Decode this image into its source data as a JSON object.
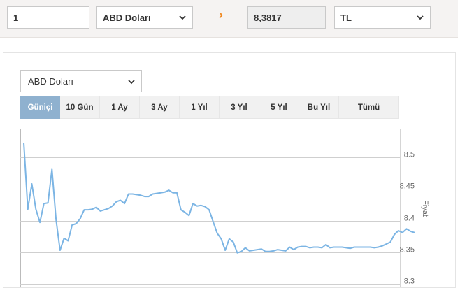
{
  "converter": {
    "amount": "1",
    "from_currency": "ABD Doları",
    "arrow": "›",
    "result": "8,3817",
    "to_currency": "TL"
  },
  "chart_panel": {
    "currency_select": "ABD Doları",
    "periods": [
      {
        "label": "Güniçi",
        "active": true
      },
      {
        "label": "10 Gün",
        "active": false
      },
      {
        "label": "1 Ay",
        "active": false
      },
      {
        "label": "3 Ay",
        "active": false
      },
      {
        "label": "1 Yıl",
        "active": false
      },
      {
        "label": "3 Yıl",
        "active": false
      },
      {
        "label": "5 Yıl",
        "active": false
      },
      {
        "label": "Bu Yıl",
        "active": false
      },
      {
        "label": "Tümü",
        "active": false
      }
    ]
  },
  "colors": {
    "accent": "#f08a24",
    "active_tab": "#8fb1cf",
    "line": "#7cb5e4"
  },
  "chart_data": {
    "type": "line",
    "ylabel": "Fiyat",
    "ylim": [
      8.3,
      8.52
    ],
    "yticks": [
      "8.5",
      "8.45",
      "8.4",
      "8.35",
      "8.3"
    ],
    "ytick_values": [
      8.5,
      8.45,
      8.4,
      8.35,
      8.3
    ],
    "series": [
      {
        "values": [
          8.523,
          8.418,
          8.458,
          8.418,
          8.397,
          8.427,
          8.428,
          8.481,
          8.402,
          8.353,
          8.372,
          8.368,
          8.393,
          8.395,
          8.403,
          8.417,
          8.417,
          8.418,
          8.421,
          8.415,
          8.417,
          8.419,
          8.423,
          8.43,
          8.432,
          8.427,
          8.442,
          8.442,
          8.441,
          8.44,
          8.438,
          8.438,
          8.442,
          8.443,
          8.444,
          8.445,
          8.448,
          8.444,
          8.444,
          8.417,
          8.413,
          8.408,
          8.427,
          8.423,
          8.424,
          8.422,
          8.417,
          8.398,
          8.38,
          8.371,
          8.353,
          8.371,
          8.366,
          8.349,
          8.351,
          8.357,
          8.352,
          8.353,
          8.354,
          8.355,
          8.351,
          8.351,
          8.352,
          8.354,
          8.353,
          8.352,
          8.358,
          8.354,
          8.358,
          8.359,
          8.359,
          8.357,
          8.358,
          8.358,
          8.357,
          8.362,
          8.357,
          8.358,
          8.358,
          8.358,
          8.357,
          8.356,
          8.358,
          8.358,
          8.358,
          8.358,
          8.358,
          8.357,
          8.358,
          8.36,
          8.363,
          8.366,
          8.378,
          8.384,
          8.381,
          8.387,
          8.383,
          8.381
        ]
      }
    ],
    "grid": true,
    "ylabel_position": "right"
  }
}
